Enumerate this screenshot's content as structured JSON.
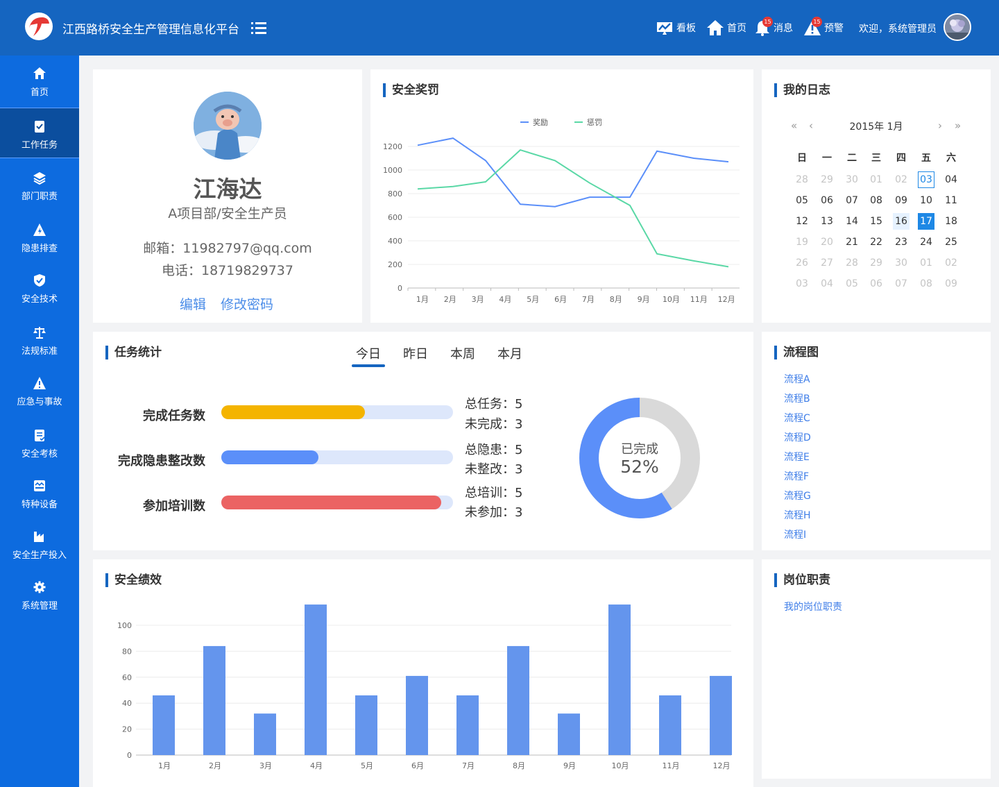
{
  "header": {
    "title": "江西路桥安全生产管理信息化平台",
    "nav": [
      {
        "label": "看板",
        "icon": "dashboard-icon"
      },
      {
        "label": "首页",
        "icon": "home-icon"
      },
      {
        "label": "消息",
        "icon": "bell-icon",
        "badge": "15"
      },
      {
        "label": "预警",
        "icon": "warning-icon",
        "badge": "15"
      }
    ],
    "welcome": "欢迎，系统管理员"
  },
  "sidebar": {
    "items": [
      {
        "label": "首页",
        "icon": "home-icon"
      },
      {
        "label": "工作任务",
        "icon": "task-icon",
        "active": true
      },
      {
        "label": "部门职责",
        "icon": "layers-icon"
      },
      {
        "label": "隐患排查",
        "icon": "hazard-icon"
      },
      {
        "label": "安全技术",
        "icon": "shield-icon"
      },
      {
        "label": "法规标准",
        "icon": "scale-icon"
      },
      {
        "label": "应急与事故",
        "icon": "alert-icon"
      },
      {
        "label": "安全考核",
        "icon": "checklist-icon"
      },
      {
        "label": "特种设备",
        "icon": "equipment-icon"
      },
      {
        "label": "安全生产投入",
        "icon": "factory-icon"
      },
      {
        "label": "系统管理",
        "icon": "gear-icon"
      }
    ]
  },
  "profile": {
    "name": "江海达",
    "department": "A项目部/安全生产员",
    "email": "邮箱：11982797@qq.com",
    "phone": "电话：18719829737",
    "edit_label": "编辑",
    "password_label": "修改密码"
  },
  "rewards": {
    "title": "安全奖罚",
    "chart_data": {
      "type": "line",
      "title": "安全奖罚",
      "categories": [
        "1月",
        "2月",
        "3月",
        "4月",
        "5月",
        "6月",
        "7月",
        "8月",
        "9月",
        "10月",
        "11月",
        "12月"
      ],
      "ylim": [
        0,
        1300
      ],
      "yticks": [
        0,
        200,
        400,
        600,
        800,
        1000,
        1200
      ],
      "legend_position": "top-center",
      "series": [
        {
          "name": "奖励",
          "color": "#5b8ff9",
          "values": [
            1210,
            1270,
            1080,
            710,
            690,
            770,
            770,
            1160,
            1100,
            1070
          ]
        },
        {
          "name": "惩罚",
          "color": "#5ad8a6",
          "values": [
            840,
            860,
            900,
            1170,
            1080,
            890,
            700,
            290,
            230,
            180
          ]
        }
      ]
    }
  },
  "diary": {
    "title": "我的日志",
    "month_label": "2015年 1月",
    "weekdays": [
      "日",
      "一",
      "二",
      "三",
      "四",
      "五",
      "六"
    ],
    "weeks": [
      [
        {
          "d": "28",
          "s": "dim"
        },
        {
          "d": "29",
          "s": "dim"
        },
        {
          "d": "30",
          "s": "dim"
        },
        {
          "d": "01",
          "s": "dim"
        },
        {
          "d": "02",
          "s": "dim"
        },
        {
          "d": "03",
          "s": "today"
        },
        {
          "d": "04",
          "s": ""
        }
      ],
      [
        {
          "d": "05",
          "s": ""
        },
        {
          "d": "06",
          "s": ""
        },
        {
          "d": "07",
          "s": ""
        },
        {
          "d": "08",
          "s": ""
        },
        {
          "d": "09",
          "s": ""
        },
        {
          "d": "10",
          "s": ""
        },
        {
          "d": "11",
          "s": ""
        }
      ],
      [
        {
          "d": "12",
          "s": ""
        },
        {
          "d": "13",
          "s": ""
        },
        {
          "d": "14",
          "s": ""
        },
        {
          "d": "15",
          "s": ""
        },
        {
          "d": "16",
          "s": "hl"
        },
        {
          "d": "17",
          "s": "sel"
        },
        {
          "d": "18",
          "s": ""
        }
      ],
      [
        {
          "d": "19",
          "s": "dim"
        },
        {
          "d": "20",
          "s": "dim"
        },
        {
          "d": "21",
          "s": ""
        },
        {
          "d": "22",
          "s": ""
        },
        {
          "d": "23",
          "s": ""
        },
        {
          "d": "24",
          "s": ""
        },
        {
          "d": "25",
          "s": ""
        }
      ],
      [
        {
          "d": "26",
          "s": "dim"
        },
        {
          "d": "27",
          "s": "dim"
        },
        {
          "d": "28",
          "s": "dim"
        },
        {
          "d": "29",
          "s": "dim"
        },
        {
          "d": "30",
          "s": "dim"
        },
        {
          "d": "01",
          "s": "dim"
        },
        {
          "d": "02",
          "s": "dim"
        }
      ],
      [
        {
          "d": "03",
          "s": "dim"
        },
        {
          "d": "04",
          "s": "dim"
        },
        {
          "d": "05",
          "s": "dim"
        },
        {
          "d": "06",
          "s": "dim"
        },
        {
          "d": "07",
          "s": "dim"
        },
        {
          "d": "08",
          "s": "dim"
        },
        {
          "d": "09",
          "s": "dim"
        }
      ]
    ]
  },
  "tasks": {
    "title": "任务统计",
    "tabs": [
      "今日",
      "昨日",
      "本周",
      "本月"
    ],
    "active_tab": 0,
    "rows": [
      {
        "label": "完成任务数",
        "progress": 0.62,
        "color": "#f4b400",
        "stat1": "总任务：5",
        "stat2": "未完成：3"
      },
      {
        "label": "完成隐患整改数",
        "progress": 0.42,
        "color": "#5b8ff9",
        "stat1": "总隐患：5",
        "stat2": "未整改：3"
      },
      {
        "label": "参加培训数",
        "progress": 0.95,
        "color": "#eb6363",
        "stat1": "总培训：5",
        "stat2": "未参加：3"
      }
    ],
    "donut": {
      "label": "已完成",
      "value": "52%",
      "percent": 0.59,
      "color": "#5b8ff9",
      "rest_color": "#d9d9d9"
    }
  },
  "flow": {
    "title": "流程图",
    "links": [
      "流程A",
      "流程B",
      "流程C",
      "流程D",
      "流程E",
      "流程F",
      "流程G",
      "流程H",
      "流程I"
    ]
  },
  "performance": {
    "title": "安全绩效",
    "chart_data": {
      "type": "bar",
      "title": "安全绩效",
      "categories": [
        "1月",
        "2月",
        "3月",
        "4月",
        "5月",
        "6月",
        "7月",
        "8月",
        "9月",
        "10月",
        "11月",
        "12月"
      ],
      "values": [
        46,
        84,
        32,
        116,
        46,
        61,
        46,
        84,
        32,
        116,
        46,
        61
      ],
      "ylim": [
        0,
        110
      ],
      "yticks": [
        0,
        20,
        40,
        60,
        80,
        100
      ],
      "color": "#6495ed"
    }
  },
  "duty": {
    "title": "岗位职责",
    "link": "我的岗位职责"
  }
}
